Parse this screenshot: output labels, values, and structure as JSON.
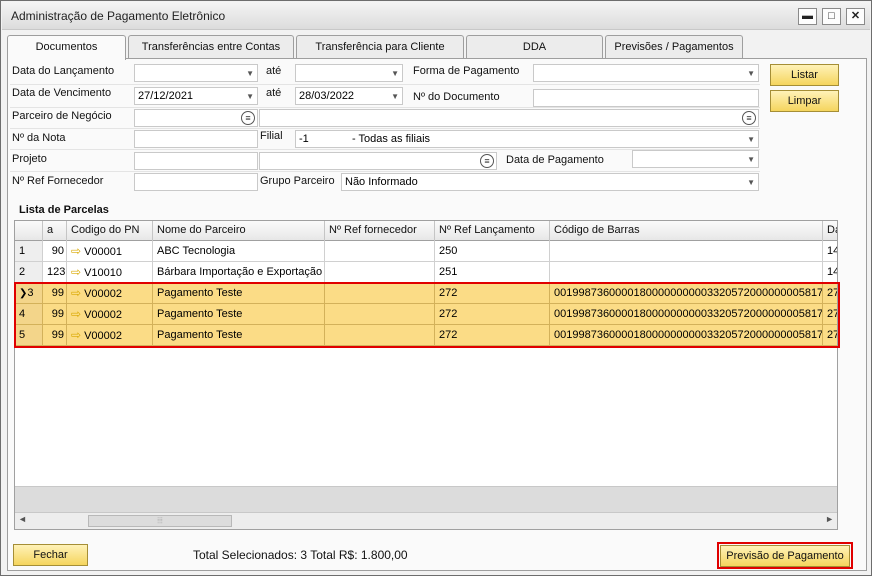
{
  "window": {
    "title": "Administração de Pagamento Eletrônico",
    "minimize": "▬",
    "maximize": "□",
    "close": "✕"
  },
  "tabs": [
    {
      "label": "Documentos"
    },
    {
      "label": "Transferências entre Contas"
    },
    {
      "label": "Transferência para Cliente"
    },
    {
      "label": "DDA"
    },
    {
      "label": "Previsões / Pagamentos"
    }
  ],
  "filters": {
    "data_lancamento_label": "Data do Lançamento",
    "ate1": "até",
    "data_lancamento_from": "",
    "data_lancamento_to": "",
    "forma_pagamento_label": "Forma de Pagamento",
    "forma_pagamento_value": "",
    "data_vencimento_label": "Data de Vencimento",
    "data_vencimento_from": "27/12/2021",
    "ate2": "até",
    "data_vencimento_to": "28/03/2022",
    "no_documento_label": "Nº do Documento",
    "no_documento_value": "",
    "parceiro_label": "Parceiro de Negócio",
    "no_nota_label": "Nº da Nota",
    "filial_label": "Filial",
    "filial_code": "-1",
    "filial_value": "- Todas as filiais",
    "projeto_label": "Projeto",
    "data_pagamento_label": "Data de Pagamento",
    "ref_fornecedor_label": "Nº Ref Fornecedor",
    "grupo_parceiro_label": "Grupo Parceiro",
    "grupo_parceiro_value": "Não Informado"
  },
  "buttons": {
    "listar": "Listar",
    "limpar": "Limpar",
    "fechar": "Fechar",
    "previsao": "Previsão de Pagamento"
  },
  "grid": {
    "title": "Lista de Parcelas",
    "columns": [
      "",
      "a",
      "Codigo do PN",
      "Nome do Parceiro",
      "Nº Ref fornecedor",
      "Nº Ref Lançamento",
      "Código de Barras",
      "Da"
    ],
    "rows": [
      {
        "n": "1",
        "a": "90",
        "pn": "V00001",
        "nome": "ABC Tecnologia",
        "ref_forn": "",
        "ref_lanc": "250",
        "barras": "",
        "da": "14",
        "selected": false
      },
      {
        "n": "2",
        "a": "123",
        "pn": "V10010",
        "nome": "Bárbara Importação e Exportação",
        "ref_forn": "",
        "ref_lanc": "251",
        "barras": "",
        "da": "14",
        "selected": false
      },
      {
        "n": "3",
        "a": "99",
        "pn": "V00002",
        "nome": "Pagamento Teste",
        "ref_forn": "",
        "ref_lanc": "272",
        "barras": "00199873600001800000000003320572000000005817",
        "da": "27",
        "selected": true,
        "current": true
      },
      {
        "n": "4",
        "a": "99",
        "pn": "V00002",
        "nome": "Pagamento Teste",
        "ref_forn": "",
        "ref_lanc": "272",
        "barras": "00199873600001800000000003320572000000005817",
        "da": "27",
        "selected": true
      },
      {
        "n": "5",
        "a": "99",
        "pn": "V00002",
        "nome": "Pagamento Teste",
        "ref_forn": "",
        "ref_lanc": "272",
        "barras": "00199873600001800000000003320572000000005817",
        "da": "27",
        "selected": true
      }
    ]
  },
  "footer": {
    "total": "Total Selecionados: 3 Total R$: 1.800,00"
  },
  "colors": {
    "selected_row": "#fbdc86",
    "highlight": "#e00000",
    "button": "#f5d55e"
  }
}
